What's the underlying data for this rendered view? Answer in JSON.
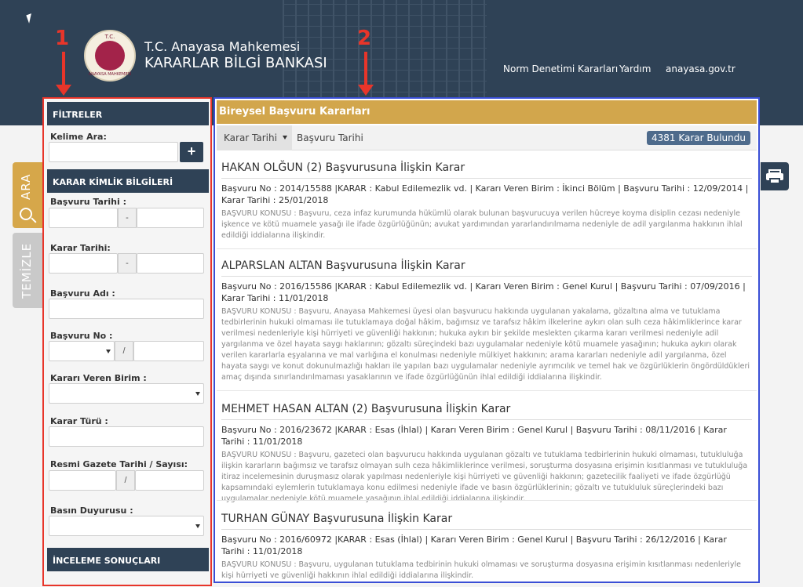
{
  "header": {
    "logo_text_top": "T.C.",
    "logo_text_bottom": "ANAYASA MAHKEMESİ",
    "title_line1": "T.C. Anayasa Mahkemesi",
    "title_line2": "KARARLAR BİLGİ BANKASI",
    "nav": [
      "Norm Denetimi Kararları",
      "Yardım",
      "anayasa.gov.tr"
    ]
  },
  "annotations": [
    "1",
    "2"
  ],
  "side_tabs": {
    "search": "ARA",
    "clear": "TEMİZLE"
  },
  "filters": {
    "heading": "FİLTRELER",
    "keyword_label": "Kelime Ara:",
    "add_button": "+",
    "section_identity": "KARAR KİMLİK BİLGİLERİ",
    "application_date_label": "Başvuru Tarihi :",
    "decision_date_label": "Karar Tarihi:",
    "range_sep": "-",
    "applicant_name_label": "Başvuru Adı :",
    "application_no_label": "Başvuru No :",
    "slash": "/",
    "unit_label": "Kararı Veren Birim :",
    "decision_type_label": "Karar Türü :",
    "gazette_label": "Resmi Gazete Tarihi / Sayısı:",
    "press_label": "Basın Duyurusu :",
    "section_review": "İNCELEME SONUÇLARI"
  },
  "main": {
    "heading": "Bireysel Başvuru Kararları",
    "sort_tabs": [
      "Karar Tarihi",
      "Başvuru Tarihi"
    ],
    "result_count": "4381 Karar Bulundu",
    "results": [
      {
        "title": "HAKAN OLĞUN (2) Başvurusuna İlişkin Karar",
        "meta": "Başvuru No : 2014/15588 |KARAR : Kabul Edilemezlik vd. | Kararı Veren Birim : İkinci Bölüm | Başvuru Tarihi : 12/09/2014 | Karar Tarihi : 25/01/2018",
        "desc": "BAŞVURU KONUSU : Başvuru, ceza infaz kurumunda hükümlü olarak bulunan başvurucuya verilen hücreye koyma disiplin cezası nedeniyle işkence ve kötü muamele yasağı ile ifade özgürlüğünün; avukat yardımından yararlandırılmama nedeniyle de adil yargılanma hakkının ihlal edildiği iddialarına ilişkindir."
      },
      {
        "title": "ALPARSLAN ALTAN Başvurusuna İlişkin Karar",
        "meta": "Başvuru No : 2016/15586 |KARAR : Kabul Edilemezlik vd. | Kararı Veren Birim : Genel Kurul | Başvuru Tarihi : 07/09/2016 | Karar Tarihi : 11/01/2018",
        "desc": "BAŞVURU KONUSU : Başvuru, Anayasa Mahkemesi üyesi olan başvurucu hakkında uygulanan yakalama, gözaltına alma ve tutuklama tedbirlerinin hukuki olmaması ile tutuklamaya doğal hâkim, bağımsız ve tarafsız hâkim ilkelerine aykırı olan sulh ceza hâkimliklerince karar verilmesi nedenleriyle kişi hürriyeti ve güvenliği hakkının; hukuka aykırı bir şekilde meslekten çıkarma kararı verilmesi nedeniyle adil yargılanma ve özel hayata saygı haklarının; gözaltı süreçindeki bazı uygulamalar nedeniyle kötü muamele yasağının; hukuka aykırı olarak verilen kararlarla eşyalarına ve mal varlığına el konulması nedeniyle mülkiyet hakkının; arama kararları nedeniyle adil yargılanma, özel hayata saygı ve konut dokunulmazlığı hakları ile yapılan bazı uygulamalar nedeniyle ayrımcılık ve temel hak ve özgürlüklerin öngördüldükleri amaç dışında sınırlandırılmaması yasaklarının ve ifade özgürlüğünün ihlal edildiği iddialarına ilişkindir."
      },
      {
        "title": "MEHMET HASAN ALTAN (2) Başvurusuna İlişkin Karar",
        "meta": "Başvuru No : 2016/23672 |KARAR : Esas (İhlal) | Kararı Veren Birim : Genel Kurul | Başvuru Tarihi : 08/11/2016 | Karar Tarihi : 11/01/2018",
        "desc": "BAŞVURU KONUSU : Başvuru, gazeteci olan başvurucu hakkında uygulanan gözaltı ve tutuklama tedbirlerinin hukuki olmaması, tutukluluğa ilişkin kararların bağımsız ve tarafsız olmayan sulh ceza hâkimliklerince verilmesi, soruşturma dosyasına erişimin kısıtlanması ve tutukluluğa itiraz incelemesinin duruşmasız olarak yapılması nedenleriyle kişi hürriyeti ve güvenliği hakkının; gazetecilik faaliyeti ve ifade özgürlüğü kapsamındaki eylemlerin tutuklamaya konu edilmesi nedeniyle ifade ve basın özgürlüklerinin; gözaltı ve tutukluluk süreçlerindeki bazı uygulamalar nedeniyle kötü muamele yasağının ihlal edildiği iddialarına ilişkindir."
      },
      {
        "title": "TURHAN GÜNAY Başvurusuna İlişkin Karar",
        "meta": "Başvuru No : 2016/60972 |KARAR : Esas (İhlal) | Kararı Veren Birim : Genel Kurul | Başvuru Tarihi : 26/12/2016 | Karar Tarihi : 11/01/2018",
        "desc": "BAŞVURU KONUSU : Başvuru, uygulanan tutuklama tedbirinin hukuki olmaması ve soruşturma dosyasına erişimin kısıtlanması nedenleriyle kişi hürriyeti ve güvenliği hakkının ihlal edildiği iddialarına ilişkindir."
      }
    ]
  },
  "icons": {
    "search": "magnifier-icon",
    "print": "printer-icon",
    "cursor": "mouse-cursor-icon"
  },
  "colors": {
    "navy": "#2f4256",
    "gold": "#d2a64c",
    "annotation_red": "#e8352a",
    "annotation_blue": "#3a4fd6",
    "badge": "#4e6b8c"
  }
}
